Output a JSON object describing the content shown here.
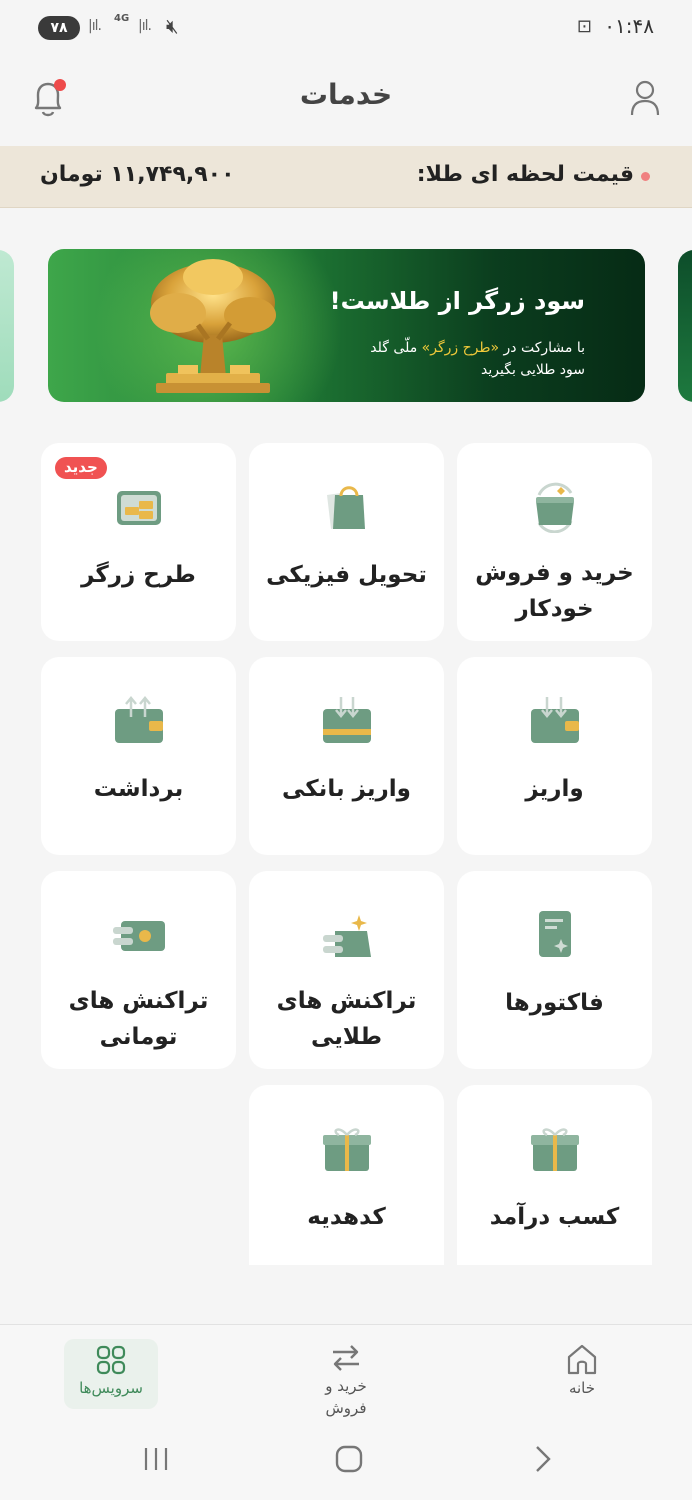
{
  "status_bar": {
    "battery": "۷۸",
    "network": "4G",
    "time": "۰۱:۴۸"
  },
  "header": {
    "title": "خدمات",
    "profile_icon": "user-icon",
    "notification_icon": "bell-icon"
  },
  "gold_price": {
    "label": "قیمت لحظه ای طلا:",
    "value": "۱۱,۷۴۹,۹۰۰ تومان"
  },
  "banner": {
    "title": "سود زرگر از طلاست!",
    "line1_prefix": "با مشارکت در ",
    "line1_highlight": "«طرح زرگر»",
    "line1_suffix": " ملّی گلد",
    "line2": "سود طلایی بگیرید"
  },
  "services": [
    {
      "label": "خرید و فروش خودکار",
      "icon": "auto-trade-wallet-icon"
    },
    {
      "label": "تحویل فیزیکی",
      "icon": "shopping-bag-icon"
    },
    {
      "label": "طرح زرگر",
      "icon": "gold-bars-card-icon",
      "badge": "جدید"
    },
    {
      "label": "واریز",
      "icon": "wallet-deposit-icon"
    },
    {
      "label": "واریز بانکی",
      "icon": "bank-deposit-card-icon"
    },
    {
      "label": "برداشت",
      "icon": "wallet-withdraw-icon"
    },
    {
      "label": "فاکتورها",
      "icon": "invoice-icon"
    },
    {
      "label": "تراکنش های طلایی",
      "icon": "gold-transactions-icon"
    },
    {
      "label": "تراکنش های تومانی",
      "icon": "toman-transactions-icon"
    },
    {
      "label": "کسب درآمد",
      "icon": "gift-box-icon"
    },
    {
      "label": "کدهدیه",
      "icon": "gift-code-icon"
    }
  ],
  "bottom_nav": {
    "home": "خانه",
    "trade": "خرید و فروش",
    "services": "سرویس‌ها",
    "active": "services"
  },
  "colors": {
    "primary_green": "#6e9c82",
    "gold": "#e9b84a",
    "badge_red": "#f05252"
  }
}
